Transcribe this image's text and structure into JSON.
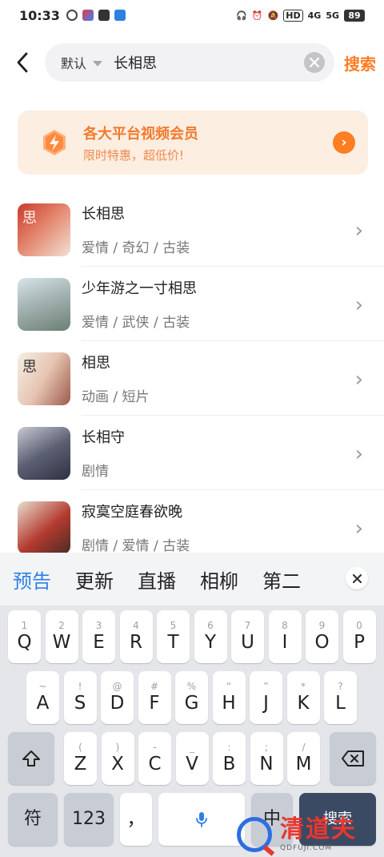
{
  "status_bar": {
    "time": "10:33",
    "network": "4G",
    "network2": "5G",
    "hd": "HD",
    "battery": "89"
  },
  "search": {
    "back_icon": "back-arrow-icon",
    "filter_label": "默认",
    "query": "长相思",
    "submit_label": "搜索"
  },
  "banner": {
    "title": "各大平台视频会员",
    "subtitle": "限时特惠，超低价!",
    "color": "#ff7e22"
  },
  "results": [
    {
      "title": "长相思",
      "tags": "爱情  /  奇幻  /  古装",
      "thumb_glyph": "思"
    },
    {
      "title": "少年游之一寸相思",
      "tags": "爱情  /  武侠  /  古装",
      "thumb_glyph": ""
    },
    {
      "title": "相思",
      "tags": "动画  /  短片",
      "thumb_glyph": "思"
    },
    {
      "title": "长相守",
      "tags": "剧情",
      "thumb_glyph": ""
    },
    {
      "title": "寂寞空庭春欲晚",
      "tags": "剧情  /  爱情  /  古装",
      "thumb_glyph": ""
    }
  ],
  "keyboard": {
    "suggestions": [
      "预告",
      "更新",
      "直播",
      "相柳",
      "第二"
    ],
    "row1": [
      {
        "k": "Q",
        "h": "1"
      },
      {
        "k": "W",
        "h": "2"
      },
      {
        "k": "E",
        "h": "3"
      },
      {
        "k": "R",
        "h": "4"
      },
      {
        "k": "T",
        "h": "5"
      },
      {
        "k": "Y",
        "h": "6"
      },
      {
        "k": "U",
        "h": "7"
      },
      {
        "k": "I",
        "h": "8"
      },
      {
        "k": "O",
        "h": "9"
      },
      {
        "k": "P",
        "h": "0"
      }
    ],
    "row2": [
      {
        "k": "A",
        "h": "~"
      },
      {
        "k": "S",
        "h": "!"
      },
      {
        "k": "D",
        "h": "@"
      },
      {
        "k": "F",
        "h": "#"
      },
      {
        "k": "G",
        "h": "%"
      },
      {
        "k": "H",
        "h": "“"
      },
      {
        "k": "J",
        "h": "”"
      },
      {
        "k": "K",
        "h": "*"
      },
      {
        "k": "L",
        "h": "?"
      }
    ],
    "row3": [
      {
        "k": "Z",
        "h": "("
      },
      {
        "k": "X",
        "h": ")"
      },
      {
        "k": "C",
        "h": "-"
      },
      {
        "k": "V",
        "h": "_"
      },
      {
        "k": "B",
        "h": ":"
      },
      {
        "k": "N",
        "h": ";"
      },
      {
        "k": "M",
        "h": "/"
      }
    ],
    "symbol_key": "符",
    "number_key": "123",
    "comma_key": "，",
    "lang_key": "中",
    "enter_key": "搜索"
  },
  "watermark": {
    "text": "清道夫",
    "url": "QDFUJI.COM"
  }
}
